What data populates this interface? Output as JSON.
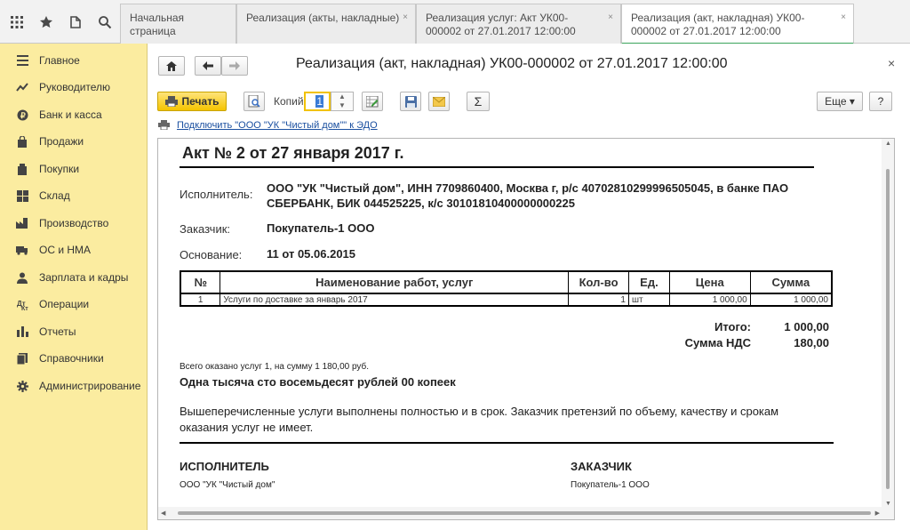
{
  "topbar": {
    "tabs": [
      {
        "label": "Начальная страница"
      },
      {
        "label": "Реализация (акты, накладные)",
        "close": "×"
      },
      {
        "label": "Реализация услуг: Акт УК00-000002 от 27.01.2017 12:00:00",
        "close": "×"
      },
      {
        "label": "Реализация (акт, накладная) УК00-000002 от 27.01.2017 12:00:00",
        "close": "×"
      }
    ]
  },
  "sidebar": {
    "items": [
      {
        "label": "Главное",
        "icon": "menu-icon"
      },
      {
        "label": "Руководителю",
        "icon": "trend-icon"
      },
      {
        "label": "Банк и касса",
        "icon": "coin-icon"
      },
      {
        "label": "Продажи",
        "icon": "bag-icon"
      },
      {
        "label": "Покупки",
        "icon": "cart-icon"
      },
      {
        "label": "Склад",
        "icon": "warehouse-icon"
      },
      {
        "label": "Производство",
        "icon": "factory-icon"
      },
      {
        "label": "ОС и НМА",
        "icon": "truck-icon"
      },
      {
        "label": "Зарплата и кадры",
        "icon": "person-icon"
      },
      {
        "label": "Операции",
        "icon": "operations-icon"
      },
      {
        "label": "Отчеты",
        "icon": "bar-chart-icon"
      },
      {
        "label": "Справочники",
        "icon": "books-icon"
      },
      {
        "label": "Администрирование",
        "icon": "gear-icon"
      }
    ]
  },
  "header": {
    "title": "Реализация (акт, накладная) УК00-000002 от 27.01.2017 12:00:00",
    "close": "×"
  },
  "toolbar": {
    "print_label": "Печать",
    "copies_label": "Копий:",
    "copies_value": "1",
    "sum_label": "Σ",
    "more_label": "Еще ▾",
    "help_label": "?"
  },
  "edo_link": "Подключить \"ООО \"УК \"Чистый дом\"\" к ЭДО",
  "document": {
    "title": "Акт № 2 от 27 января 2017 г.",
    "executor_label": "Исполнитель:",
    "executor_line1": "ООО \"УК \"Чистый дом\", ИНН 7709860400, Москва г, р/с 40702810299996505045, в банке ПАО",
    "executor_line2": "СБЕРБАНК, БИК 044525225, к/с 30101810400000000225",
    "customer_label": "Заказчик:",
    "customer_value": "Покупатель-1 ООО",
    "basis_label": "Основание:",
    "basis_value": "11 от 05.06.2015",
    "table": {
      "headers": [
        "№",
        "Наименование работ, услуг",
        "Кол-во",
        "Ед.",
        "Цена",
        "Сумма"
      ],
      "rows": [
        [
          "1",
          "Услуги по доставке за январь 2017",
          "1",
          "шт",
          "1 000,00",
          "1 000,00"
        ]
      ]
    },
    "total_label": "Итого:",
    "total_value": "1 000,00",
    "vat_label": "Сумма НДС",
    "vat_value": "180,00",
    "summary_line": "Всего оказано услуг 1, на сумму 1 180,00 руб.",
    "amount_words": "Одна тысяча сто восемьдесят рублей 00 копеек",
    "statement_line1": "Вышеперечисленные услуги выполнены полностью и в срок. Заказчик претензий по объему, качеству и срокам",
    "statement_line2": "оказания услуг не имеет.",
    "executor_sign_title": "ИСПОЛНИТЕЛЬ",
    "executor_sign_name": "ООО \"УК \"Чистый дом\"",
    "customer_sign_title": "ЗАКАЗЧИК",
    "customer_sign_name": "Покупатель-1 ООО"
  }
}
